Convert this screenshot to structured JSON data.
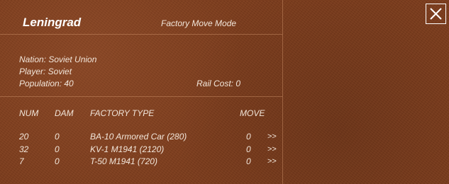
{
  "header": {
    "city_name": "Leningrad",
    "mode_label": "Factory Move Mode"
  },
  "info": {
    "nation": "Nation: Soviet Union",
    "player": "Player: Soviet",
    "population": "Population: 40",
    "rail_cost": "Rail Cost: 0"
  },
  "table": {
    "columns": {
      "num": "NUM",
      "dam": "DAM",
      "type": "FACTORY TYPE",
      "move": "MOVE"
    },
    "rows": [
      {
        "num": "20",
        "dam": "0",
        "type": "BA-10 Armored Car (280)",
        "move": "0",
        "action": ">>"
      },
      {
        "num": "32",
        "dam": "0",
        "type": "KV-1 M1941 (2120)",
        "move": "0",
        "action": ">>"
      },
      {
        "num": "7",
        "dam": "0",
        "type": "T-50 M1941 (720)",
        "move": "0",
        "action": ">>"
      }
    ]
  },
  "icons": {
    "close": "close-icon"
  },
  "colors": {
    "background": "#7b3a1a",
    "text": "#f2e6da",
    "title": "#ffffff"
  }
}
